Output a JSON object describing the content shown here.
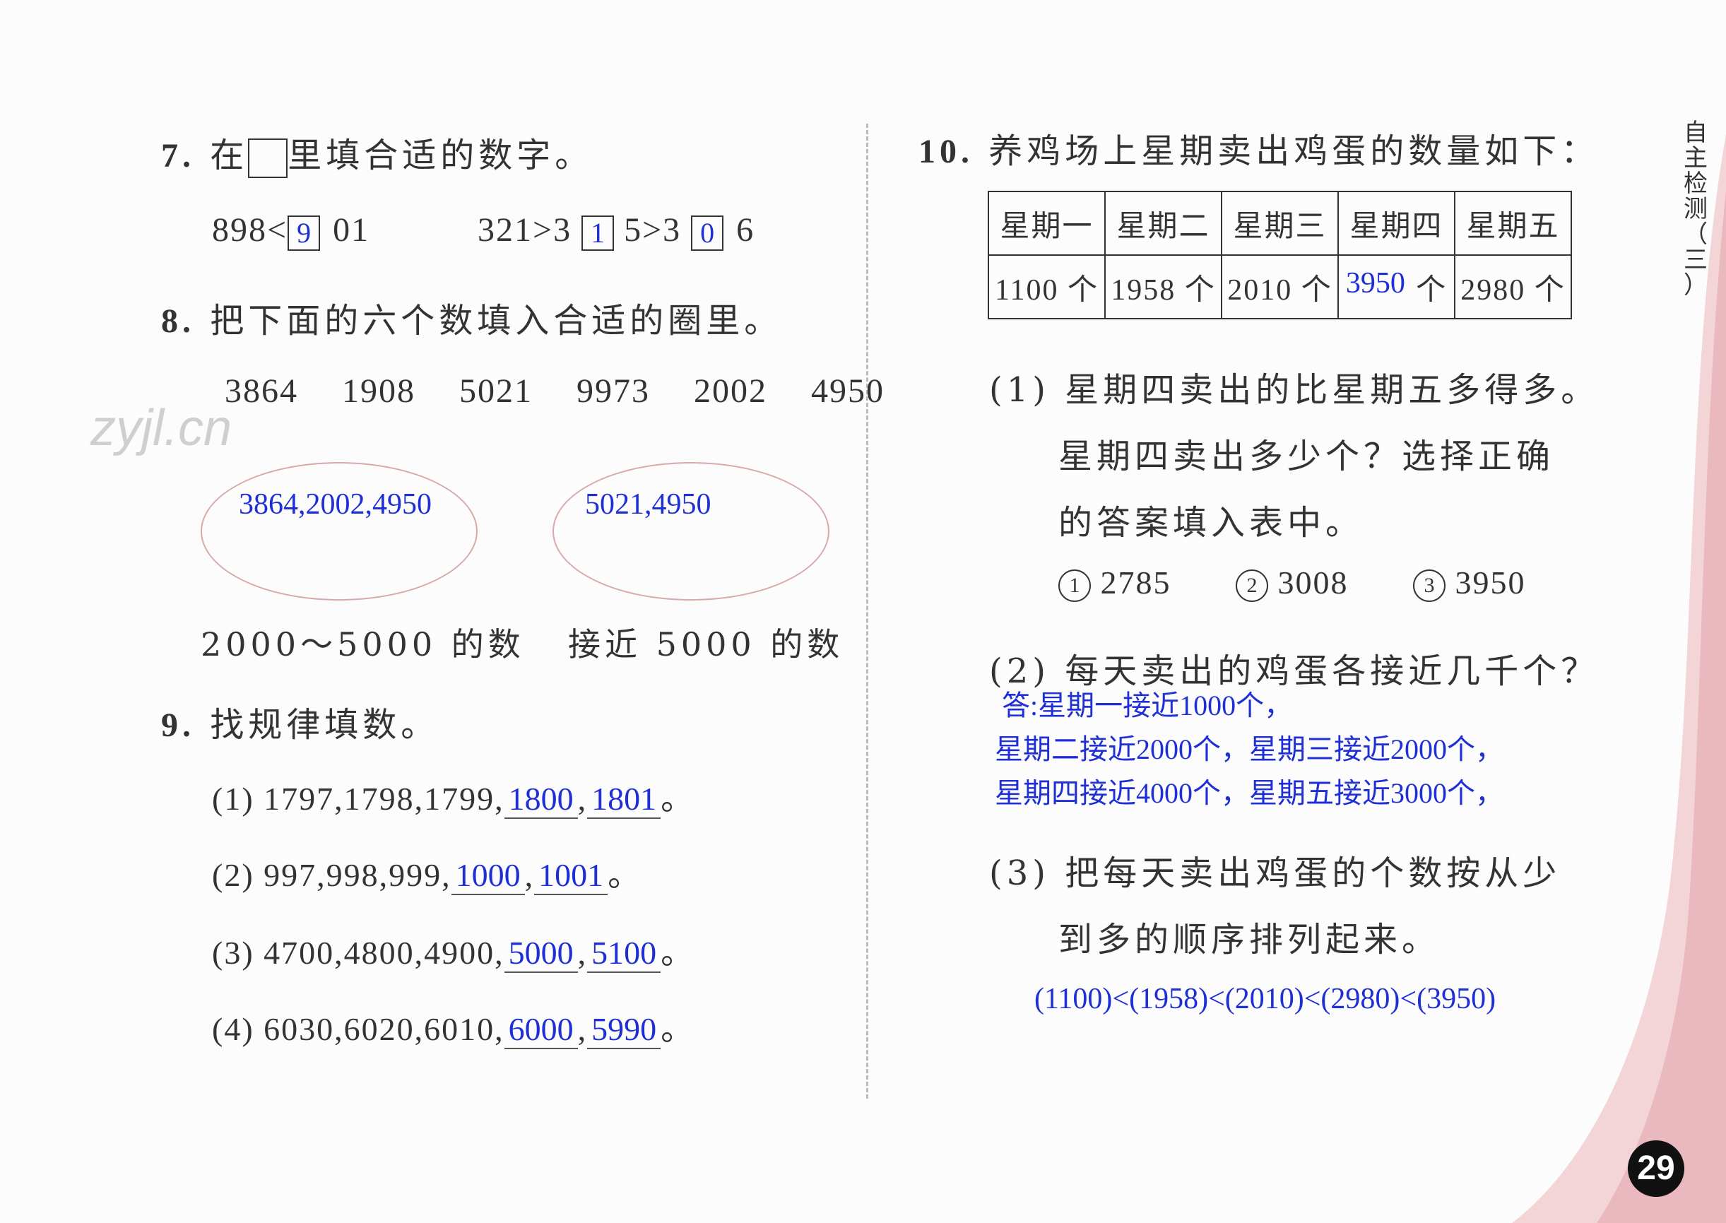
{
  "watermark": "zyjl.cn",
  "q7": {
    "num": "7.",
    "pre": "在",
    "post": "里填合适的数字。",
    "e1_left": "898<",
    "e1_box": "9",
    "e1_right": "01",
    "e2_left": "321>3",
    "e2_box": "1",
    "e2_mid": "5>3",
    "e2_box2": "0",
    "e2_right": "6"
  },
  "q8": {
    "num": "8.",
    "text": "把下面的六个数填入合适的圈里。",
    "numbers": [
      "3864",
      "1908",
      "5021",
      "9973",
      "2002",
      "4950"
    ],
    "oval1_answer": "3864,2002,4950",
    "oval2_answer": "5021,4950",
    "label1": "2000～5000 的数",
    "label2": "接近 5000 的数"
  },
  "q9": {
    "num": "9.",
    "text": "找规律填数。",
    "items": [
      {
        "prefix": "(1) 1797,1798,1799,",
        "a": "1800",
        "b": "1801"
      },
      {
        "prefix": "(2) 997,998,999,",
        "a": "1000",
        "b": "1001"
      },
      {
        "prefix": "(3) 4700,4800,4900,",
        "a": "5000",
        "b": "5100"
      },
      {
        "prefix": "(4) 6030,6020,6010,",
        "a": "6000",
        "b": "5990"
      }
    ],
    "comma": ",",
    "end": "。"
  },
  "q10": {
    "num": "10.",
    "text": "养鸡场上星期卖出鸡蛋的数量如下：",
    "headers": [
      "星期一",
      "星期二",
      "星期三",
      "星期四",
      "星期五"
    ],
    "values": [
      "1100 个",
      "1958 个",
      "2010 个",
      "",
      "2980 个"
    ],
    "thu_answer": "3950",
    "thu_unit": "个",
    "p1_line1": "(1) 星期四卖出的比星期五多得多。",
    "p1_line2": "星期四卖出多少个？选择正确",
    "p1_line3": "的答案填入表中。",
    "options": [
      {
        "mark": "1",
        "value": "2785"
      },
      {
        "mark": "2",
        "value": "3008"
      },
      {
        "mark": "3",
        "value": "3950"
      }
    ],
    "p2_line": "(2) 每天卖出的鸡蛋各接近几千个？",
    "p2_ans1": "答:星期一接近1000个，",
    "p2_ans2": "星期二接近2000个，星期三接近2000个，",
    "p2_ans3": "星期四接近4000个，星期五接近3000个，",
    "p3_line1": "(3) 把每天卖出鸡蛋的个数按从少",
    "p3_line2": "到多的顺序排列起来。",
    "p3_answer": "(1100)<(1958)<(2010)<(2980)<(3950)"
  },
  "side_label": [
    "自",
    "主",
    "检",
    "测",
    "（",
    "三",
    "）"
  ],
  "page_number": "29",
  "colors": {
    "answer": "#1f2fd6",
    "accent": "#e8b7bd"
  }
}
